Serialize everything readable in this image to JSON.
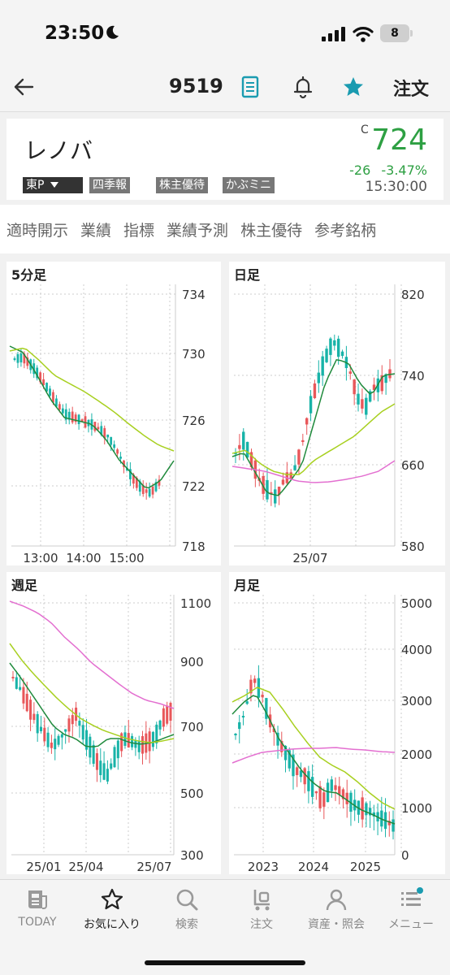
{
  "status_bar": {
    "time": "23:50",
    "battery": "8",
    "icons": [
      "moon-icon",
      "signal-icon",
      "wifi-icon",
      "battery-icon"
    ]
  },
  "nav": {
    "code": "9519",
    "order": "注文",
    "icons": [
      "back-arrow-icon",
      "document-icon",
      "bell-icon",
      "star-icon"
    ],
    "accent_color": "#1a9bb0"
  },
  "stock": {
    "name": "レノバ",
    "tags": [
      "東P",
      "四季報",
      "株主優待",
      "かぶミニ"
    ],
    "price_flag": "C",
    "price": "724",
    "change": "-26",
    "change_pct": "-3.47%",
    "time": "15:30:00",
    "price_color": "#2ea043"
  },
  "tabs": [
    "適時開示",
    "業績",
    "指標",
    "業績予測",
    "株主優待",
    "参考銘柄"
  ],
  "charts": {
    "five_min": {
      "title": "5分足",
      "y_labels": [
        "734",
        "730",
        "726",
        "722",
        "718"
      ],
      "x_labels": [
        "13:00",
        "14:00",
        "15:00"
      ]
    },
    "daily": {
      "title": "日足",
      "y_labels": [
        "820",
        "740",
        "660",
        "580"
      ],
      "x_labels": [
        "25/07"
      ]
    },
    "weekly": {
      "title": "週足",
      "y_labels": [
        "1100",
        "900",
        "700",
        "500",
        "300"
      ],
      "x_labels": [
        "25/01",
        "25/04",
        "25/07"
      ]
    },
    "monthly": {
      "title": "月足",
      "y_labels": [
        "5000",
        "4000",
        "3000",
        "2000",
        "1000",
        "0"
      ],
      "x_labels": [
        "2023",
        "2024",
        "2025"
      ]
    }
  },
  "chart_colors": {
    "up": "#e8575a",
    "down": "#18b3a8",
    "ma_short": "#1f8a3c",
    "ma_mid": "#a8d020",
    "ma_long": "#e36fd0"
  },
  "tabbar": [
    {
      "label": "TODAY",
      "icon": "news-icon"
    },
    {
      "label": "お気に入り",
      "icon": "star-outline-icon"
    },
    {
      "label": "検索",
      "icon": "search-icon"
    },
    {
      "label": "注文",
      "icon": "cart-icon"
    },
    {
      "label": "資産・照会",
      "icon": "person-icon"
    },
    {
      "label": "メニュー",
      "icon": "menu-icon"
    }
  ]
}
